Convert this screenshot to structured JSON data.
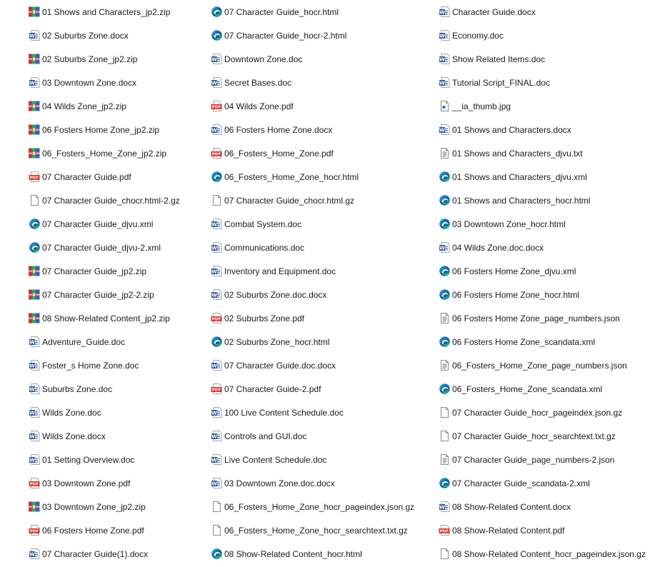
{
  "columns": [
    [
      {
        "name": "01 Shows and Characters_jp2.zip",
        "icon": "winrar-archive-icon"
      },
      {
        "name": "02 Suburbs Zone.docx",
        "icon": "word-document-icon"
      },
      {
        "name": "02 Suburbs Zone_jp2.zip",
        "icon": "winrar-archive-icon"
      },
      {
        "name": "03 Downtown Zone.docx",
        "icon": "word-document-icon"
      },
      {
        "name": "04 Wilds Zone_jp2.zip",
        "icon": "winrar-archive-icon"
      },
      {
        "name": "06 Fosters Home Zone_jp2.zip",
        "icon": "winrar-archive-icon"
      },
      {
        "name": "06_Fosters_Home_Zone_jp2.zip",
        "icon": "winrar-archive-icon"
      },
      {
        "name": "07 Character Guide.pdf",
        "icon": "pdf-document-icon"
      },
      {
        "name": "07 Character Guide_chocr.html-2.gz",
        "icon": "blank-file-icon"
      },
      {
        "name": "07 Character Guide_djvu.xml",
        "icon": "edge-browser-icon"
      },
      {
        "name": "07 Character Guide_djvu-2.xml",
        "icon": "edge-browser-icon"
      },
      {
        "name": "07 Character Guide_jp2.zip",
        "icon": "winrar-archive-icon"
      },
      {
        "name": "07 Character Guide_jp2-2.zip",
        "icon": "winrar-archive-icon"
      },
      {
        "name": "08 Show-Related Content_jp2.zip",
        "icon": "winrar-archive-icon"
      },
      {
        "name": "Adventure_Guide.doc",
        "icon": "word-document-icon"
      },
      {
        "name": "Foster_s Home Zone.doc",
        "icon": "word-document-icon"
      },
      {
        "name": "Suburbs Zone.doc",
        "icon": "word-document-icon"
      },
      {
        "name": "Wilds Zone.doc",
        "icon": "word-document-icon"
      },
      {
        "name": "Wilds Zone.docx",
        "icon": "word-document-icon"
      },
      {
        "name": "01 Setting Overview.doc",
        "icon": "word-document-icon"
      },
      {
        "name": "03 Downtown Zone.pdf",
        "icon": "pdf-document-icon"
      },
      {
        "name": "03 Downtown Zone_jp2.zip",
        "icon": "winrar-archive-icon"
      },
      {
        "name": "06 Fosters Home Zone.pdf",
        "icon": "pdf-document-icon"
      },
      {
        "name": "07 Character Guide(1).docx",
        "icon": "word-document-icon"
      }
    ],
    [
      {
        "name": "07 Character Guide_hocr.html",
        "icon": "edge-browser-icon"
      },
      {
        "name": "07 Character Guide_hocr-2.html",
        "icon": "edge-browser-icon"
      },
      {
        "name": "Downtown Zone.doc",
        "icon": "word-document-icon"
      },
      {
        "name": "Secret Bases.doc",
        "icon": "word-document-icon"
      },
      {
        "name": "04 Wilds Zone.pdf",
        "icon": "pdf-document-icon"
      },
      {
        "name": "06 Fosters Home Zone.docx",
        "icon": "word-document-icon"
      },
      {
        "name": "06_Fosters_Home_Zone.pdf",
        "icon": "pdf-document-icon"
      },
      {
        "name": "06_Fosters_Home_Zone_hocr.html",
        "icon": "edge-browser-icon"
      },
      {
        "name": "07 Character Guide_chocr.html.gz",
        "icon": "blank-file-icon"
      },
      {
        "name": "Combat System.doc",
        "icon": "word-document-icon"
      },
      {
        "name": "Communications.doc",
        "icon": "word-document-icon"
      },
      {
        "name": "Inventory and Equipment.doc",
        "icon": "word-document-icon"
      },
      {
        "name": "02 Suburbs Zone.doc.docx",
        "icon": "word-document-icon"
      },
      {
        "name": "02 Suburbs Zone.pdf",
        "icon": "pdf-document-icon"
      },
      {
        "name": "02 Suburbs Zone_hocr.html",
        "icon": "edge-browser-icon"
      },
      {
        "name": "07 Character Guide.doc.docx",
        "icon": "word-document-icon"
      },
      {
        "name": "07 Character Guide-2.pdf",
        "icon": "pdf-document-icon"
      },
      {
        "name": "100 Live Content Schedule.doc",
        "icon": "word-document-icon"
      },
      {
        "name": "Controls and GUI.doc",
        "icon": "word-document-icon"
      },
      {
        "name": "Live Content Schedule.doc",
        "icon": "word-document-icon"
      },
      {
        "name": "03 Downtown Zone.doc.docx",
        "icon": "word-document-icon"
      },
      {
        "name": "06_Fosters_Home_Zone_hocr_pageindex.json.gz",
        "icon": "blank-file-icon"
      },
      {
        "name": "06_Fosters_Home_Zone_hocr_searchtext.txt.gz",
        "icon": "blank-file-icon"
      },
      {
        "name": "08 Show-Related Content_hocr.html",
        "icon": "edge-browser-icon"
      }
    ],
    [
      {
        "name": "Character Guide.docx",
        "icon": "word-document-icon"
      },
      {
        "name": "Economy.doc",
        "icon": "word-document-icon"
      },
      {
        "name": "Show Related Items.doc",
        "icon": "word-document-icon"
      },
      {
        "name": "Tutorial Script_FINAL.doc",
        "icon": "word-document-icon"
      },
      {
        "name": "__ia_thumb.jpg",
        "icon": "image-file-icon"
      },
      {
        "name": "01 Shows and Characters.docx",
        "icon": "word-document-icon"
      },
      {
        "name": "01 Shows and Characters_djvu.txt",
        "icon": "text-file-icon"
      },
      {
        "name": "01 Shows and Characters_djvu.xml",
        "icon": "edge-browser-icon"
      },
      {
        "name": "01 Shows and Characters_hocr.html",
        "icon": "edge-browser-icon"
      },
      {
        "name": "03 Downtown Zone_hocr.html",
        "icon": "edge-browser-icon"
      },
      {
        "name": "04 Wilds Zone.doc.docx",
        "icon": "word-document-icon"
      },
      {
        "name": "06 Fosters Home Zone_djvu.xml",
        "icon": "edge-browser-icon"
      },
      {
        "name": "06 Fosters Home Zone_hocr.html",
        "icon": "edge-browser-icon"
      },
      {
        "name": "06 Fosters Home Zone_page_numbers.json",
        "icon": "text-file-icon"
      },
      {
        "name": "06 Fosters Home Zone_scandata.xml",
        "icon": "edge-browser-icon"
      },
      {
        "name": "06_Fosters_Home_Zone_page_numbers.json",
        "icon": "text-file-icon"
      },
      {
        "name": "06_Fosters_Home_Zone_scandata.xml",
        "icon": "edge-browser-icon"
      },
      {
        "name": "07 Character Guide_hocr_pageindex.json.gz",
        "icon": "blank-file-icon"
      },
      {
        "name": "07 Character Guide_hocr_searchtext.txt.gz",
        "icon": "blank-file-icon"
      },
      {
        "name": "07 Character Guide_page_numbers-2.json",
        "icon": "text-file-icon"
      },
      {
        "name": "07 Character Guide_scandata-2.xml",
        "icon": "edge-browser-icon"
      },
      {
        "name": "08 Show-Related Content.docx",
        "icon": "word-document-icon"
      },
      {
        "name": "08 Show-Related Content.pdf",
        "icon": "pdf-document-icon"
      },
      {
        "name": "08 Show-Related Content_hocr_pageindex.json.gz",
        "icon": "blank-file-icon"
      }
    ]
  ],
  "icon_colors": {
    "word": "#2b579a",
    "pdf": "#d93025",
    "edge_blue": "#0c59a4",
    "edge_green": "#3bc15a",
    "edge_cyan": "#1ebbee",
    "rar_red": "#c0392b",
    "rar_green": "#27ae60",
    "rar_blue": "#2962c9",
    "rar_purple": "#8e44ad",
    "file_border": "#8a8a8a"
  }
}
